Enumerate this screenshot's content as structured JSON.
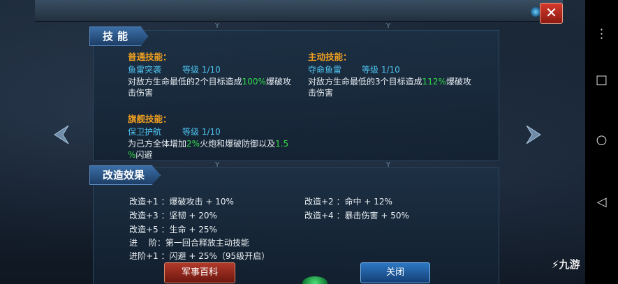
{
  "window": {
    "close_glyph": "✕"
  },
  "skills": {
    "tab_label": "技能",
    "normal": {
      "header": "普通技能：",
      "name": "鱼雷突袭",
      "level": "等级 1/10",
      "desc_pre": "对敌方生命最低的2个目标造成",
      "desc_hl": "100%",
      "desc_post": "爆破攻",
      "desc_line2": "击伤害"
    },
    "active": {
      "header": "主动技能：",
      "name": "夺命鱼雷",
      "level": "等级 1/10",
      "desc_pre": "对敌方生命最低的3个目标造成",
      "desc_hl": "112%",
      "desc_post": "爆破攻",
      "desc_line2": "击伤害"
    },
    "flagship": {
      "header": "旗舰技能：",
      "name": "保卫护航",
      "level": "等级 1/10",
      "desc_pre": "为己方全体增加",
      "desc_hl1": "2%",
      "desc_mid": "火炮和爆破防御以及",
      "desc_hl2": "1.5",
      "desc_line2_hl": "%",
      "desc_line2": "闪避"
    }
  },
  "refit": {
    "tab_label": "改造效果",
    "left": [
      "改造+1 ：爆破攻击 + 10%",
      "改造+3 ：坚韧 + 20%",
      "改造+5 ：生命 + 25%",
      "进　 阶：第一回合释放主动技能",
      "进阶+1 ：闪避 + 25%（95级开启）"
    ],
    "right": [
      "改造+2 ：命中 + 12%",
      "改造+4 ：暴击伤害 + 50%"
    ]
  },
  "buttons": {
    "encyclopedia": "军事百科",
    "close": "关闭"
  },
  "android_nav": {
    "menu": "⋮",
    "recent": "□",
    "home": "○",
    "back": "◁"
  },
  "watermark": "九游",
  "colors": {
    "orange": "#f0a020",
    "cyan": "#4ec3f0",
    "green": "#32d84a",
    "close_red": "#d33a2c"
  },
  "icons": [
    "close-icon",
    "left-arrow-icon",
    "right-arrow-icon",
    "menu-dots-icon",
    "recent-apps-icon",
    "home-icon",
    "back-icon"
  ]
}
